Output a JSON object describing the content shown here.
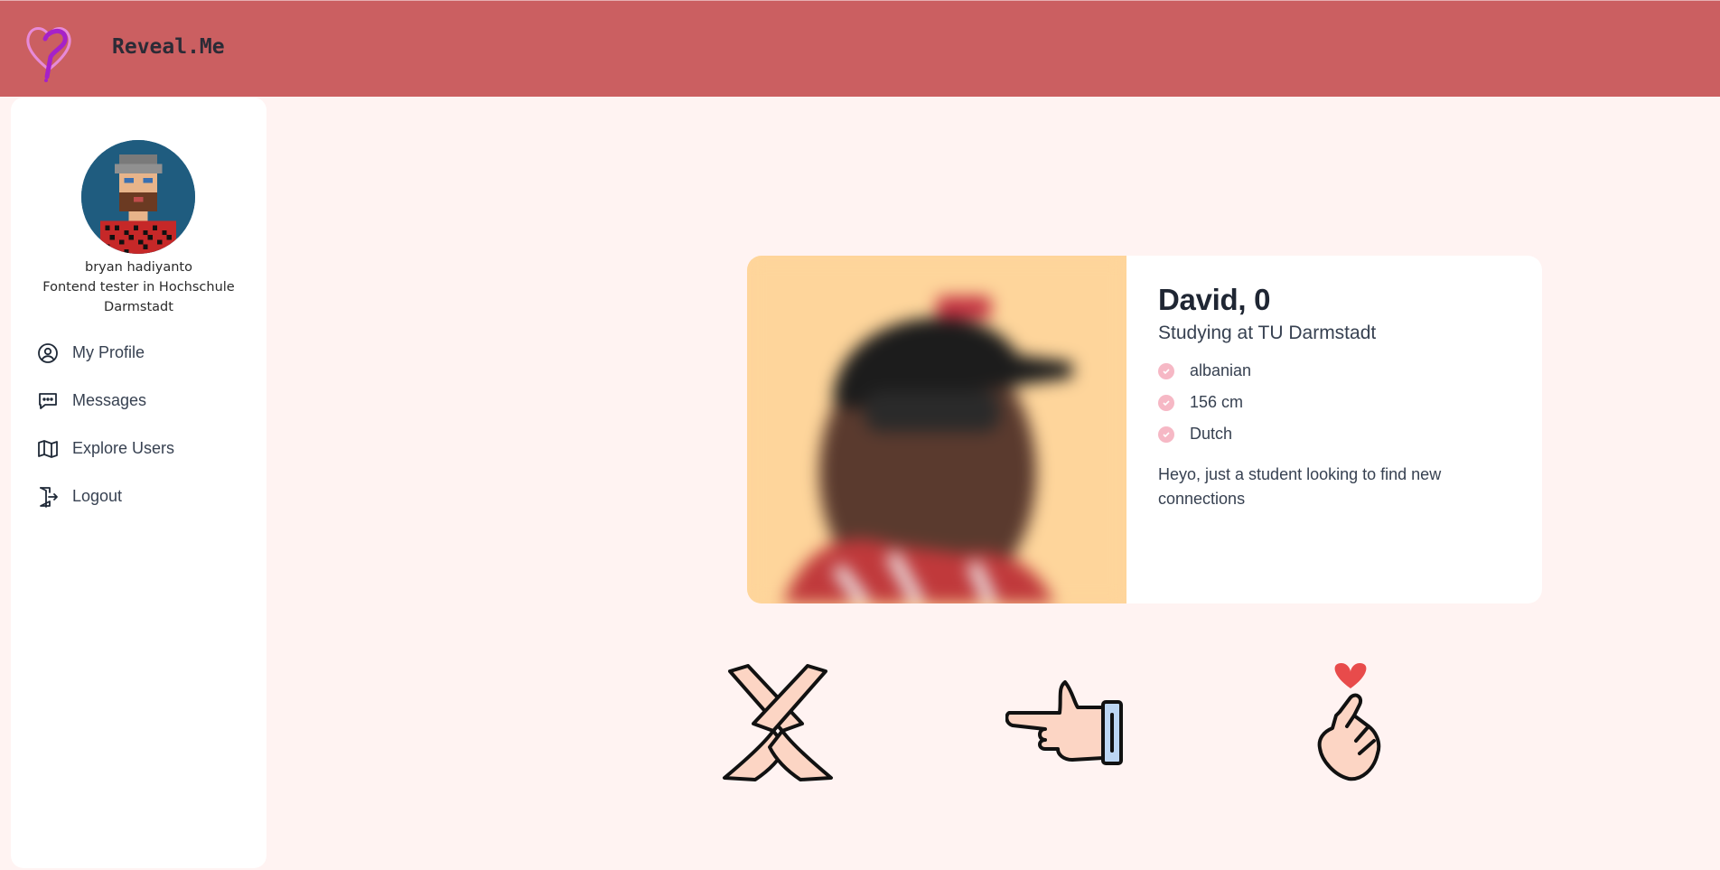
{
  "app": {
    "brand": "Reveal.Me",
    "logo_icon": "heart-question-logo-icon",
    "header_color": "#cb5f61",
    "page_background": "#fff3f2"
  },
  "sidebar": {
    "user": {
      "name": "bryan hadiyanto",
      "bio": "Fontend tester in Hochschule Darmstadt"
    },
    "items": [
      {
        "label": "My Profile",
        "icon": "user-circle-icon"
      },
      {
        "label": "Messages",
        "icon": "chat-bubble-icon"
      },
      {
        "label": "Explore Users",
        "icon": "map-icon"
      },
      {
        "label": "Logout",
        "icon": "logout-door-icon"
      }
    ]
  },
  "profile_card": {
    "title": "David, 0",
    "subtitle": "Studying at TU Darmstadt",
    "traits": [
      "albanian",
      "156 cm",
      "Dutch"
    ],
    "about": "Heyo, just a student looking to find new connections",
    "photo_blurred": true
  },
  "actions": [
    {
      "name": "reject",
      "icon": "crossed-hands-icon"
    },
    {
      "name": "next",
      "icon": "pointing-hand-icon"
    },
    {
      "name": "like",
      "icon": "finger-heart-icon"
    }
  ]
}
